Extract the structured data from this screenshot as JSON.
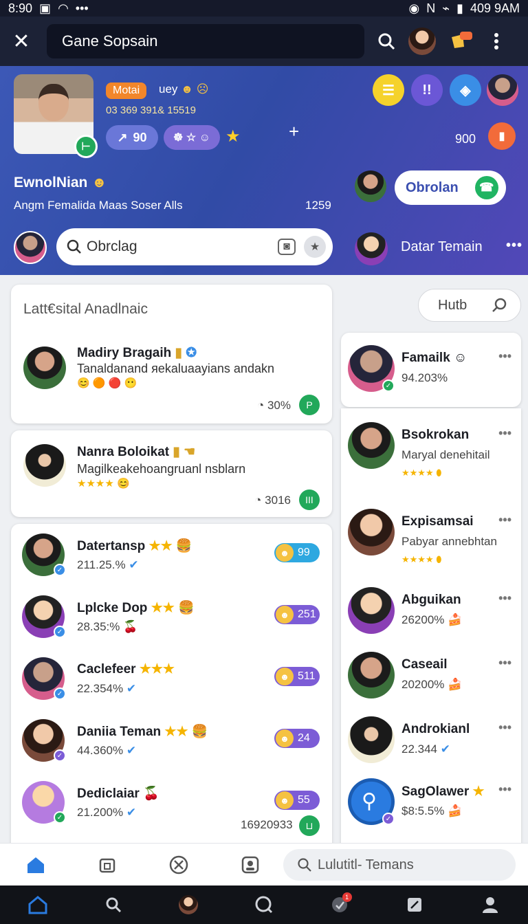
{
  "status_bar": {
    "time": "8:90",
    "right_time": "409 9AM"
  },
  "app_bar": {
    "title": "Gane Sopsain"
  },
  "profile": {
    "tag": "Motai",
    "line1": "uey",
    "stats": "03 369  391&  15519",
    "pill1": "90",
    "pill2": "☸ ☆ ☺",
    "side_count": "900",
    "name": "EwnolNian",
    "subtitle": "Angm  Femalida Maas Soser Alls",
    "count": "1259",
    "chat_button": "Obrolan",
    "search_placeholder": "Obrclag",
    "friends_title": "Datar Temain"
  },
  "feed": {
    "title": "Latt€sital Anadlnaic",
    "posts": [
      {
        "name": "Madiry Bragaih",
        "message": "Tanaldanand яekaluaayians andakn",
        "count": "30%"
      },
      {
        "name": "Nanra Boloikat",
        "message": "Magilkeakehoangruanl nsblarn",
        "count": "3016"
      }
    ],
    "friends": [
      {
        "name": "Datertansp",
        "stat": "211.25.%",
        "score": "99",
        "color": "#2ea8e0"
      },
      {
        "name": "Lplcke Dop",
        "stat": "28.35:%",
        "score": "251",
        "color": "#7c5cd6"
      },
      {
        "name": "Caclefeer",
        "stat": "22.354%",
        "score": "511",
        "color": "#7c5cd6"
      },
      {
        "name": "Daniia Teman",
        "stat": "44.360%",
        "score": "24",
        "color": "#7c5cd6"
      },
      {
        "name": "Dediclaiar",
        "stat": "21.200%",
        "score": "55",
        "color": "#7c5cd6"
      }
    ],
    "footer_count": "16920933"
  },
  "hub_label": "Hutb",
  "right_list": [
    {
      "name": "Famailk",
      "stat": "94.203%"
    },
    {
      "name": "Bsokrokan",
      "stat": "Maryal denehitail"
    },
    {
      "name": "Expisamsai",
      "stat": "Pabyar annebhtan"
    },
    {
      "name": "Abguikan",
      "stat": "26200%"
    },
    {
      "name": "Caseail",
      "stat": "20200%"
    },
    {
      "name": "Androkianl",
      "stat": "22.344"
    },
    {
      "name": "SagOlawer",
      "stat": "$8:5.5%"
    }
  ],
  "bottom_search": "Lulutitl- Temans",
  "colors": {
    "header_start": "#3c58b6",
    "header_end": "#5248b8",
    "accent": "#2a7be0",
    "online": "#22a85a"
  }
}
